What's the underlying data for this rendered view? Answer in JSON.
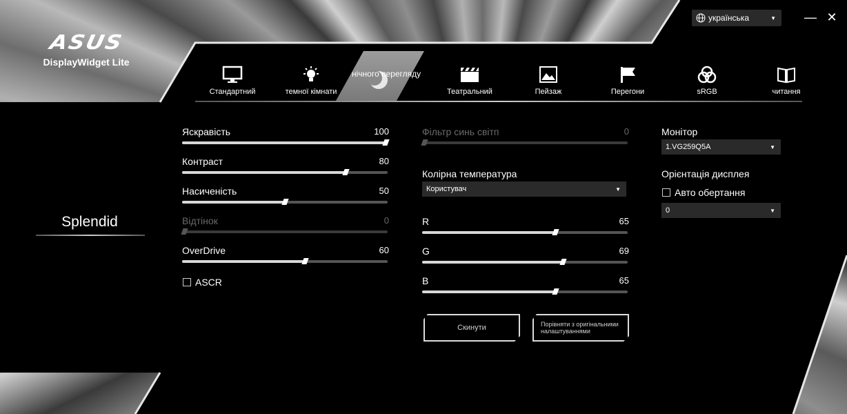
{
  "app": {
    "brand": "ASUS",
    "name": "DisplayWidget Lite"
  },
  "language": {
    "selected": "українська",
    "icon": "globe-icon"
  },
  "window": {
    "minimize": "—",
    "close": "✕"
  },
  "tabs": [
    {
      "label": "Стандартний",
      "icon": "monitor-icon"
    },
    {
      "label": "темної кімнати",
      "icon": "bulb-icon"
    },
    {
      "label": "нічного перегляду",
      "icon": "moon-icon",
      "active": true
    },
    {
      "label": "Театральний",
      "icon": "clapper-icon"
    },
    {
      "label": "Пейзаж",
      "icon": "landscape-icon"
    },
    {
      "label": "Перегони",
      "icon": "flag-icon"
    },
    {
      "label": "sRGB",
      "icon": "rgb-icon"
    },
    {
      "label": "читання",
      "icon": "book-icon"
    }
  ],
  "section": {
    "title": "Splendid"
  },
  "left_sliders": [
    {
      "label": "Яскравість",
      "value": "100",
      "percent": 100,
      "disabled": false
    },
    {
      "label": "Контраст",
      "value": "80",
      "percent": 80,
      "disabled": false
    },
    {
      "label": "Насиченість",
      "value": "50",
      "percent": 50,
      "disabled": false
    },
    {
      "label": "Відтінок",
      "value": "0",
      "percent": 0,
      "disabled": true
    },
    {
      "label": "OverDrive",
      "value": "60",
      "percent": 60,
      "disabled": false
    }
  ],
  "ascr": {
    "label": "ASCR",
    "checked": false
  },
  "blue_filter": {
    "label": "Фільтр синь світп",
    "value": "0",
    "percent": 0,
    "disabled": true
  },
  "color_temp": {
    "label": "Колірна температура",
    "selected": "Користувач"
  },
  "rgb_sliders": [
    {
      "label": "R",
      "value": "65",
      "percent": 65
    },
    {
      "label": "G",
      "value": "69",
      "percent": 69
    },
    {
      "label": "B",
      "value": "65",
      "percent": 65
    }
  ],
  "buttons": {
    "reset": "Скинути",
    "compare": "Порівняти з оригінальними налаштуваннями"
  },
  "monitor": {
    "label": "Монітор",
    "selected": "1.VG259Q5A"
  },
  "orientation": {
    "label": "Орієнтація дисплея",
    "auto_label": "Авто обертання",
    "auto_checked": false,
    "selected": "0"
  }
}
